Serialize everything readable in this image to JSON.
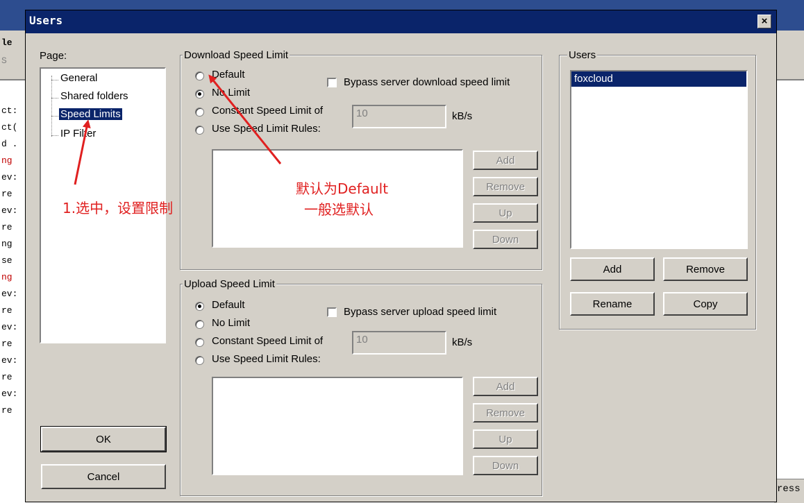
{
  "background": {
    "log_lines": [
      "le",
      "S",
      "",
      "",
      "ct:",
      "ct(",
      "d .",
      "ng",
      "ev:",
      "re",
      "ev:",
      "re",
      "ng",
      "se",
      "ng",
      "ev:",
      "re",
      "ev:",
      "re",
      "ev:",
      "re",
      "ev:",
      "re"
    ],
    "status_text": "ress"
  },
  "dialog": {
    "title": "Users",
    "close_glyph": "×",
    "page_label": "Page:",
    "pages": [
      "General",
      "Shared folders",
      "Speed Limits",
      "IP Filter"
    ],
    "ok_label": "OK",
    "cancel_label": "Cancel"
  },
  "download": {
    "group_label": "Download Speed Limit",
    "options": [
      "Default",
      "No Limit",
      "Constant Speed Limit of",
      "Use Speed Limit Rules:"
    ],
    "selected": "No Limit",
    "bypass_label": "Bypass server download speed limit",
    "limit_value": "10",
    "unit": "kB/s",
    "buttons": [
      "Add",
      "Remove",
      "Up",
      "Down"
    ]
  },
  "upload": {
    "group_label": "Upload Speed Limit",
    "options": [
      "Default",
      "No Limit",
      "Constant Speed Limit of",
      "Use Speed Limit Rules:"
    ],
    "selected": "Default",
    "bypass_label": "Bypass server upload speed limit",
    "limit_value": "10",
    "unit": "kB/s",
    "buttons": [
      "Add",
      "Remove",
      "Up",
      "Down"
    ]
  },
  "users": {
    "group_label": "Users",
    "list": [
      "foxcloud"
    ],
    "add_label": "Add",
    "remove_label": "Remove",
    "rename_label": "Rename",
    "copy_label": "Copy"
  },
  "annotations": {
    "step1": "1.选中，设置限制",
    "default_note_line1": "默认为Default",
    "default_note_line2": "一般选默认",
    "color": "#e02020"
  }
}
